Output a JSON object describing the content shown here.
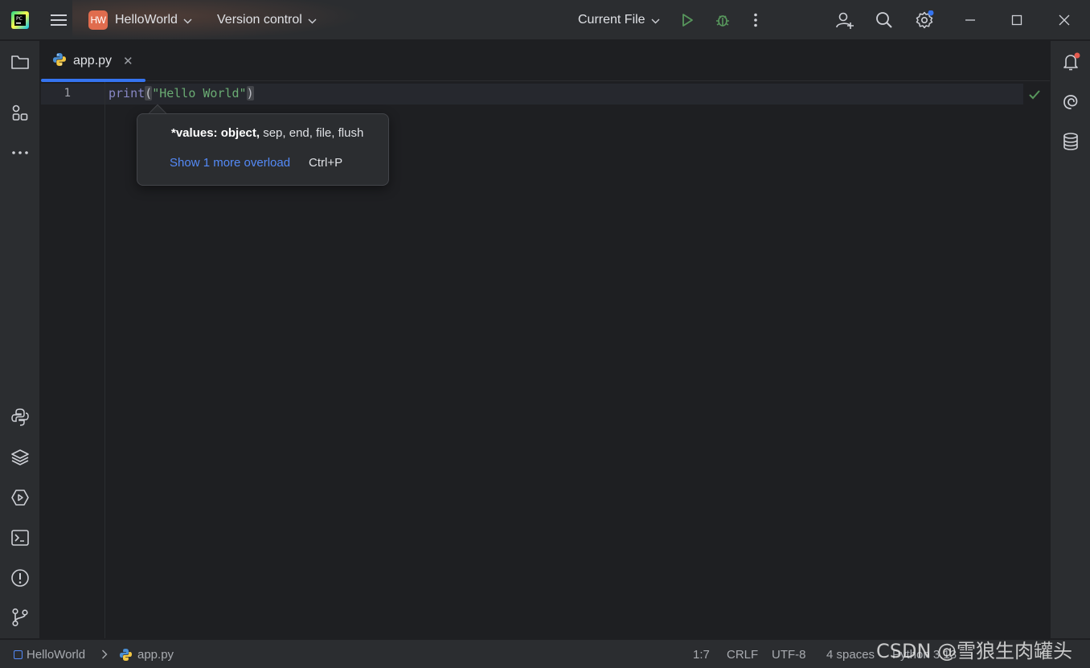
{
  "titlebar": {
    "project_badge": "HW",
    "project_name": "HelloWorld",
    "vcs_label": "Version control",
    "run_config": "Current File"
  },
  "tabs": [
    {
      "label": "app.py",
      "active": true
    }
  ],
  "editor": {
    "line_numbers": [
      "1"
    ],
    "code": {
      "keyword": "print",
      "open_paren": "(",
      "string": "\"Hello World\"",
      "close_paren": ")"
    }
  },
  "param_popup": {
    "param_bold": "*values: object,",
    "param_rest": " sep, end, file, flush",
    "more_link": "Show 1 more overload",
    "shortcut": "Ctrl+P"
  },
  "statusbar": {
    "breadcrumb_project": "HelloWorld",
    "breadcrumb_file": "app.py",
    "position": "1:7",
    "line_ending": "CRLF",
    "encoding": "UTF-8",
    "indent": "4 spaces",
    "interpreter": "Python 3.13"
  },
  "watermark": "CSDN @雪狼生肉罐头",
  "colors": {
    "accent": "#3574f0",
    "run": "#57965c",
    "keyword": "#8888c6",
    "string": "#6aab73",
    "link": "#548af7",
    "badge": "#e06c4e"
  },
  "icons": {
    "left_top": [
      "folder-icon",
      "structure-icon",
      "more-horizontal-icon"
    ],
    "left_bottom": [
      "python-console-icon",
      "layers-icon",
      "services-icon",
      "terminal-icon",
      "problems-icon",
      "git-icon"
    ],
    "right": [
      "notifications-icon",
      "ai-assistant-icon",
      "database-icon"
    ]
  }
}
